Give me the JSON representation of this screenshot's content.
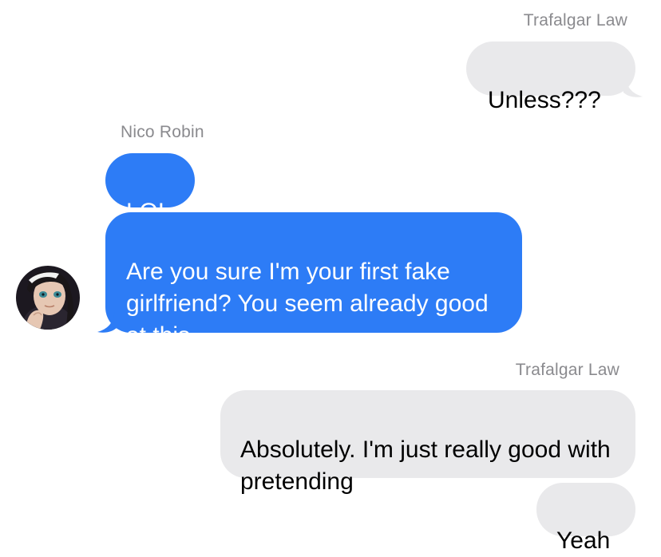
{
  "conversation": {
    "messages": [
      {
        "sender": "Trafalgar Law",
        "text": "Unless???",
        "direction": "outgoing"
      },
      {
        "sender": "Nico Robin",
        "text": "LOL",
        "direction": "incoming"
      },
      {
        "sender": "Nico Robin",
        "text": "Are you sure I'm your first fake girlfriend? You seem already good at this",
        "direction": "incoming"
      },
      {
        "sender": "Trafalgar Law",
        "text": "Absolutely. I'm just really good with pretending",
        "direction": "outgoing"
      },
      {
        "sender": "Trafalgar Law",
        "text": "Yeah",
        "direction": "outgoing"
      }
    ],
    "sender_labels": {
      "first": "Trafalgar Law",
      "second": "Nico Robin",
      "third": "Trafalgar Law"
    },
    "avatar_icon": "contact-avatar-nico-robin"
  },
  "colors": {
    "incoming_bubble": "#2d7cf6",
    "outgoing_bubble": "#e9e9eb",
    "sender_label": "#8a8a8e"
  }
}
